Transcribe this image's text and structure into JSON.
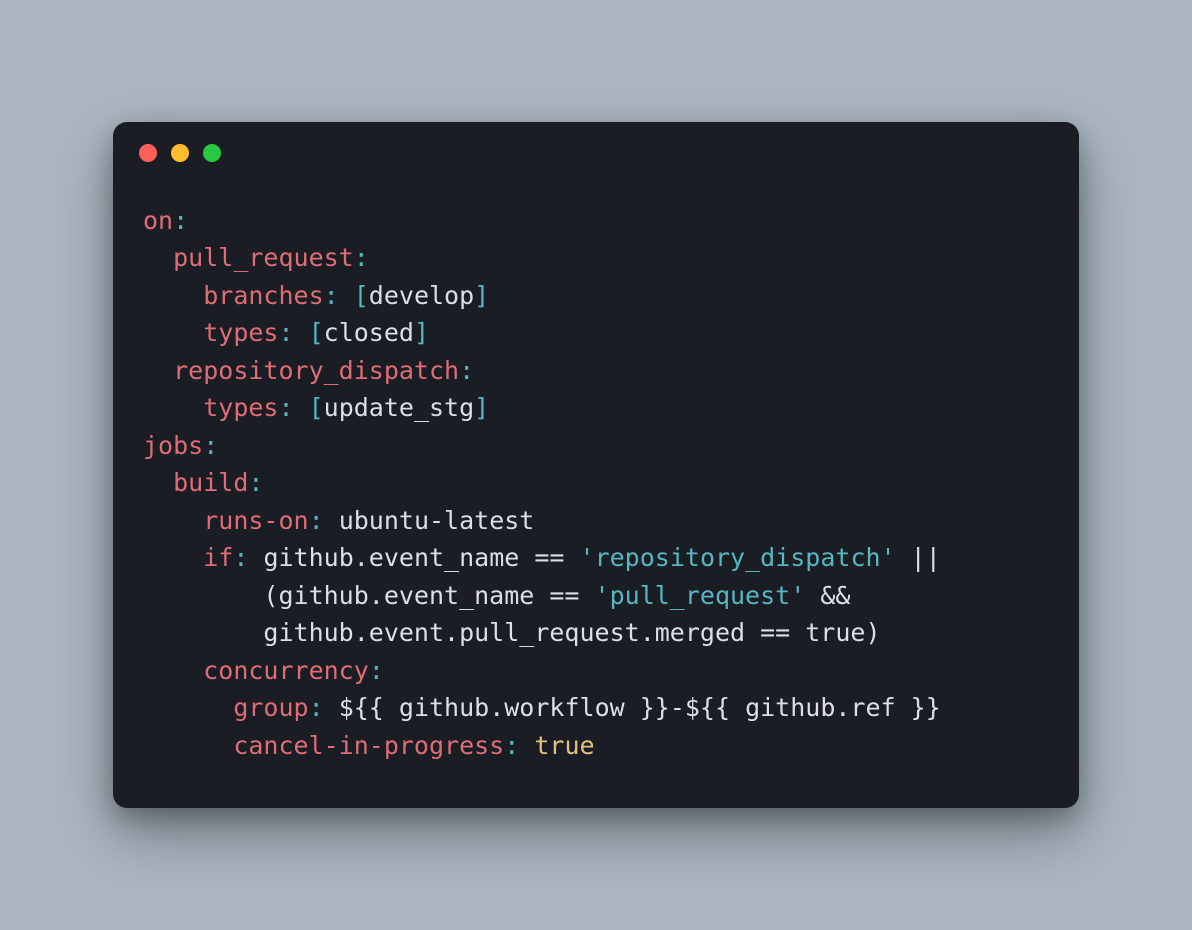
{
  "traffic_lights": [
    "red",
    "yellow",
    "green"
  ],
  "tokens": [
    [
      {
        "c": "k-red",
        "t": "on"
      },
      {
        "c": "k-cyan",
        "t": ":"
      }
    ],
    [
      {
        "c": "k-white",
        "t": "  "
      },
      {
        "c": "k-red",
        "t": "pull_request"
      },
      {
        "c": "k-cyan",
        "t": ":"
      }
    ],
    [
      {
        "c": "k-white",
        "t": "    "
      },
      {
        "c": "k-red",
        "t": "branches"
      },
      {
        "c": "k-cyan",
        "t": ": ["
      },
      {
        "c": "k-white",
        "t": "develop"
      },
      {
        "c": "k-cyan",
        "t": "]"
      }
    ],
    [
      {
        "c": "k-white",
        "t": "    "
      },
      {
        "c": "k-red",
        "t": "types"
      },
      {
        "c": "k-cyan",
        "t": ": ["
      },
      {
        "c": "k-white",
        "t": "closed"
      },
      {
        "c": "k-cyan",
        "t": "]"
      }
    ],
    [
      {
        "c": "k-white",
        "t": "  "
      },
      {
        "c": "k-red",
        "t": "repository_dispatch"
      },
      {
        "c": "k-cyan",
        "t": ":"
      }
    ],
    [
      {
        "c": "k-white",
        "t": "    "
      },
      {
        "c": "k-red",
        "t": "types"
      },
      {
        "c": "k-cyan",
        "t": ": ["
      },
      {
        "c": "k-white",
        "t": "update_stg"
      },
      {
        "c": "k-cyan",
        "t": "]"
      }
    ],
    [
      {
        "c": "k-red",
        "t": "jobs"
      },
      {
        "c": "k-cyan",
        "t": ":"
      }
    ],
    [
      {
        "c": "k-white",
        "t": "  "
      },
      {
        "c": "k-red",
        "t": "build"
      },
      {
        "c": "k-cyan",
        "t": ":"
      }
    ],
    [
      {
        "c": "k-white",
        "t": "    "
      },
      {
        "c": "k-red",
        "t": "runs-on"
      },
      {
        "c": "k-cyan",
        "t": ":"
      },
      {
        "c": "k-white",
        "t": " ubuntu-latest"
      }
    ],
    [
      {
        "c": "k-white",
        "t": "    "
      },
      {
        "c": "k-red",
        "t": "if"
      },
      {
        "c": "k-cyan",
        "t": ":"
      },
      {
        "c": "k-white",
        "t": " github.event_name == "
      },
      {
        "c": "k-str",
        "t": "'repository_dispatch'"
      },
      {
        "c": "k-white",
        "t": " || "
      }
    ],
    [
      {
        "c": "k-white",
        "t": "        (github.event_name == "
      },
      {
        "c": "k-str",
        "t": "'pull_request'"
      },
      {
        "c": "k-white",
        "t": " && "
      }
    ],
    [
      {
        "c": "k-white",
        "t": "        github.event.pull_request.merged == true)"
      }
    ],
    [
      {
        "c": "k-white",
        "t": "    "
      },
      {
        "c": "k-red",
        "t": "concurrency"
      },
      {
        "c": "k-cyan",
        "t": ":"
      }
    ],
    [
      {
        "c": "k-white",
        "t": "      "
      },
      {
        "c": "k-red",
        "t": "group"
      },
      {
        "c": "k-cyan",
        "t": ":"
      },
      {
        "c": "k-white",
        "t": " ${{ github.workflow }}-${{ github.ref }}"
      }
    ],
    [
      {
        "c": "k-white",
        "t": "      "
      },
      {
        "c": "k-red",
        "t": "cancel-in-progress"
      },
      {
        "c": "k-cyan",
        "t": ":"
      },
      {
        "c": "k-white",
        "t": " "
      },
      {
        "c": "k-yellow",
        "t": "true"
      }
    ]
  ]
}
